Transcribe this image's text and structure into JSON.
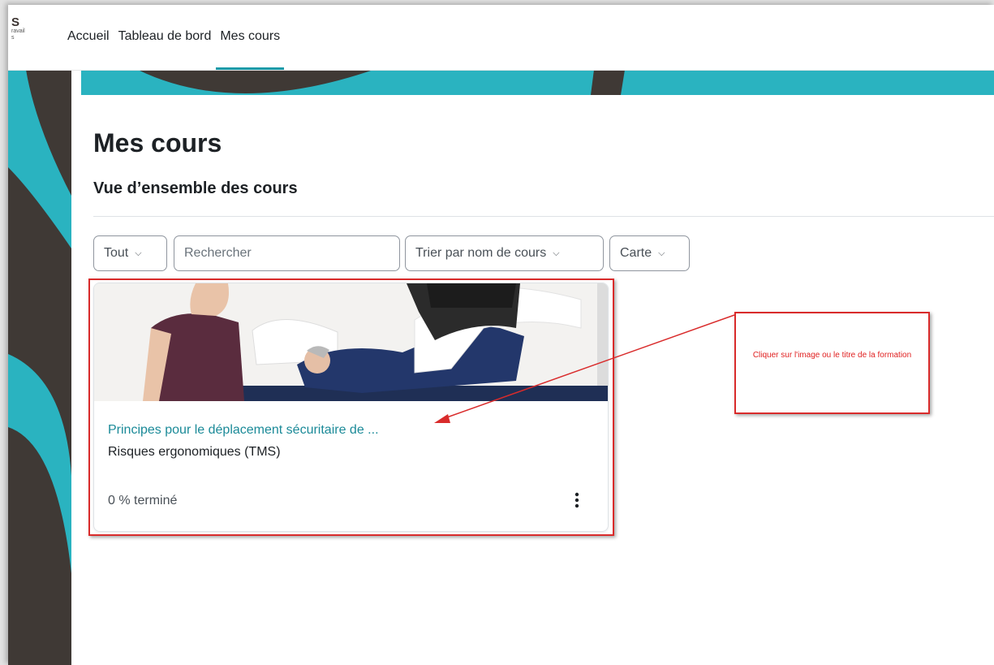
{
  "brand": {
    "initial": "S",
    "sub_line_1": "ravail",
    "sub_line_2": "s"
  },
  "nav": {
    "items": [
      {
        "label": "Accueil",
        "active": false
      },
      {
        "label": "Tableau de bord",
        "active": false
      },
      {
        "label": "Mes cours",
        "active": true
      }
    ]
  },
  "page": {
    "title": "Mes cours",
    "subtitle": "Vue d’ensemble des cours"
  },
  "filters": {
    "grouping": {
      "label": "Tout",
      "icon": "chevron-down-icon"
    },
    "search": {
      "placeholder": "Rechercher",
      "value": ""
    },
    "sort": {
      "label": "Trier par nom de cours",
      "icon": "chevron-down-icon"
    },
    "view": {
      "label": "Carte",
      "icon": "chevron-down-icon"
    }
  },
  "courses": [
    {
      "title": "Principes pour le déplacement sécuritaire de ...",
      "category": "Risques ergonomiques (TMS)",
      "progress_text": "0 % terminé",
      "progress_percent": 0,
      "menu_icon": "kebab-menu-icon"
    }
  ],
  "annotation": {
    "text": "Cliquer sur l'image ou le titre de la formation"
  },
  "colors": {
    "accent_teal": "#2ab3c0",
    "dark_brown": "#3f3935",
    "link": "#1b8a98",
    "annotation_red": "#d92b2b"
  }
}
